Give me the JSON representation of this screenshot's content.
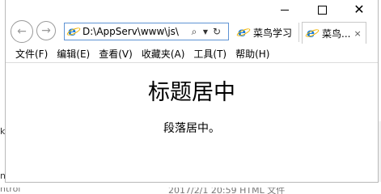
{
  "behind": {
    "left_char_a": "t",
    "left_char_b": "nt",
    "bottom_text": "2017/2/1 20:59      HTML 文件",
    "bottom_left": "ntrol"
  },
  "window": {
    "controls": {
      "minimize": "—",
      "maximize": "☐",
      "close": "✕"
    }
  },
  "nav": {
    "back": "←",
    "forward": "→",
    "address": "D:\\AppServ\\www\\js\\‹",
    "address_display": "D:\\AppServ\\www\\js\\",
    "search_icon": "search-icon",
    "refresh": "↻"
  },
  "tabs": [
    {
      "label": "菜鸟学习"
    },
    {
      "label": "菜鸟...",
      "close": "×"
    }
  ],
  "menu": [
    "文件(F)",
    "编辑(E)",
    "查看(V)",
    "收藏夹(A)",
    "工具(T)",
    "帮助(H)"
  ],
  "page": {
    "heading": "标题居中",
    "paragraph": "段落居中。"
  }
}
